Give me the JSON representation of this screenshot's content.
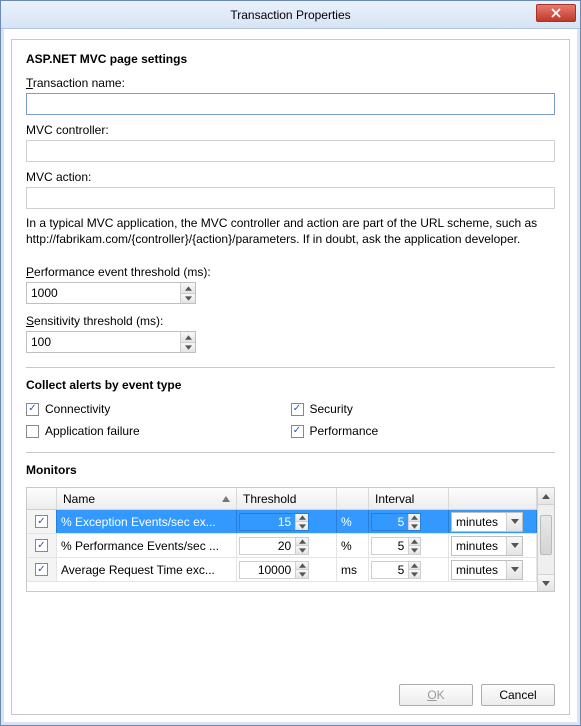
{
  "title": "Transaction Properties",
  "section1": {
    "heading": "ASP.NET MVC page settings",
    "transaction_label_pre": "T",
    "transaction_label_rest": "ransaction name:",
    "transaction_value": "",
    "controller_label": "MVC controller:",
    "controller_value": "",
    "action_label": "MVC action:",
    "action_value": "",
    "helptext": "In a typical MVC application, the MVC controller and action are part of the URL scheme, such as http://fabrikam.com/{controller}/{action}/parameters. If in doubt, ask the application developer."
  },
  "perf_label_pre": "P",
  "perf_label_rest": "erformance event threshold (ms):",
  "perf_value": "1000",
  "sens_label_pre": "S",
  "sens_label_rest": "ensitivity threshold (ms):",
  "sens_value": "100",
  "alerts_heading": "Collect alerts by event type",
  "cb_connectivity": "Connectivity",
  "cb_security": "Security",
  "cb_appfailure": "Application failure",
  "cb_performance": "Performance",
  "monitors_heading": "Monitors",
  "monitors": {
    "cols": {
      "name": "Name",
      "threshold": "Threshold",
      "interval": "Interval"
    },
    "rows": [
      {
        "name": "% Exception Events/sec ex...",
        "threshold": "15",
        "unit": "%",
        "interval": "5",
        "interval_unit": "minutes",
        "checked": true,
        "selected": true
      },
      {
        "name": "% Performance Events/sec ...",
        "threshold": "20",
        "unit": "%",
        "interval": "5",
        "interval_unit": "minutes",
        "checked": true,
        "selected": false
      },
      {
        "name": "Average Request Time exc...",
        "threshold": "10000",
        "unit": "ms",
        "interval": "5",
        "interval_unit": "minutes",
        "checked": true,
        "selected": false
      }
    ]
  },
  "buttons": {
    "ok_pre": "O",
    "ok_rest": "K",
    "cancel": "Cancel"
  }
}
